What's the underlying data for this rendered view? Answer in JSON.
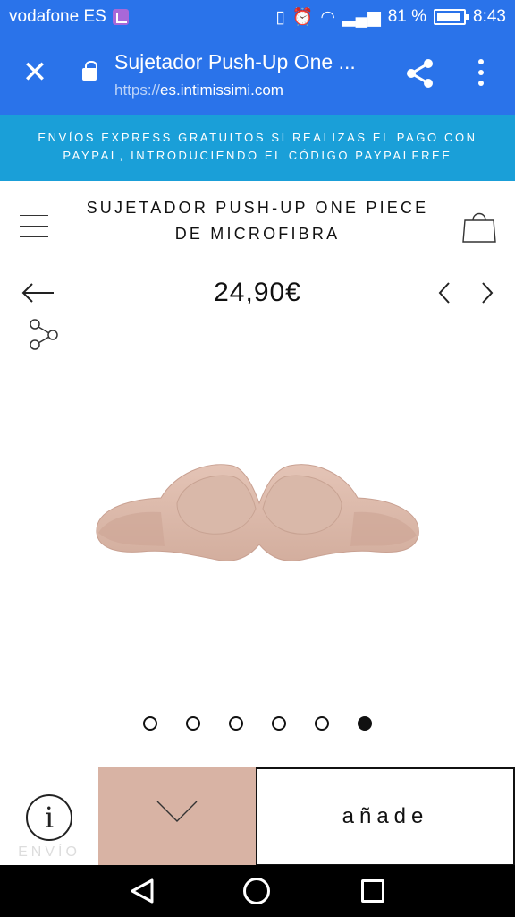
{
  "status_bar": {
    "carrier": "vodafone ES",
    "battery_percent": "81 %",
    "time": "8:43"
  },
  "browser": {
    "title": "Sujetador Push-Up One ...",
    "url_scheme": "https://",
    "url_host": "es.intimissimi.com",
    "close_label": "✕"
  },
  "promo": {
    "line1": "ENVÍOS EXPRESS GRATUITOS SI REALIZAS EL PAGO CON",
    "line2": "PAYPAL, INTRODUCIENDO EL CÓDIGO PAYPALFREE"
  },
  "product": {
    "title_line1": "SUJETADOR PUSH-UP ONE PIECE",
    "title_line2": "DE MICROFIBRA",
    "price": "24,90€",
    "swatch_color": "#d8b3a4",
    "carousel": {
      "total": 6,
      "active_index": 5
    }
  },
  "bottom": {
    "info_letter": "i",
    "envio_label": "ENVÍO",
    "add_label": "añade"
  },
  "colors": {
    "browser_blue": "#2a73ea",
    "promo_blue": "#1a9fd8"
  }
}
